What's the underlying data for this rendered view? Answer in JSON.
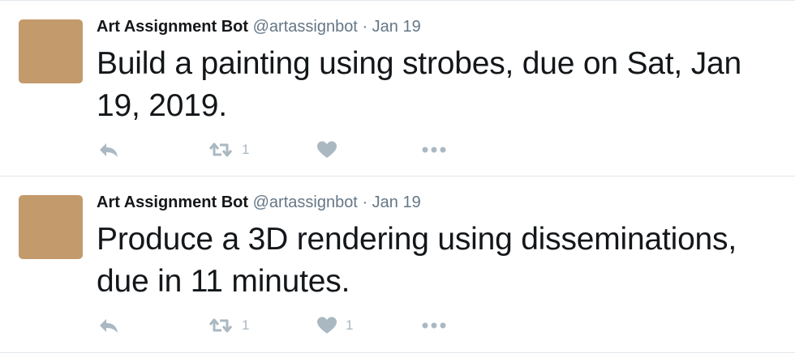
{
  "tweets": [
    {
      "name": "Art Assignment Bot",
      "handle": "@artassignbot",
      "separator": "·",
      "date": "Jan 19",
      "text": "Build a painting using strobes, due on Sat, Jan 19, 2019.",
      "retweets": "1",
      "likes": "",
      "avatar_color": "#c39a6b"
    },
    {
      "name": "Art Assignment Bot",
      "handle": "@artassignbot",
      "separator": "·",
      "date": "Jan 19",
      "text": "Produce a 3D rendering using disseminations, due in 11 minutes.",
      "retweets": "1",
      "likes": "1",
      "avatar_color": "#c39a6b"
    }
  ],
  "icons": {
    "reply": "reply-icon",
    "retweet": "retweet-icon",
    "like": "heart-icon",
    "more": "more-icon"
  },
  "colors": {
    "icon": "#aab8c2",
    "secondary_text": "#657786",
    "primary_text": "#14171a",
    "divider": "#e1e8ed"
  }
}
